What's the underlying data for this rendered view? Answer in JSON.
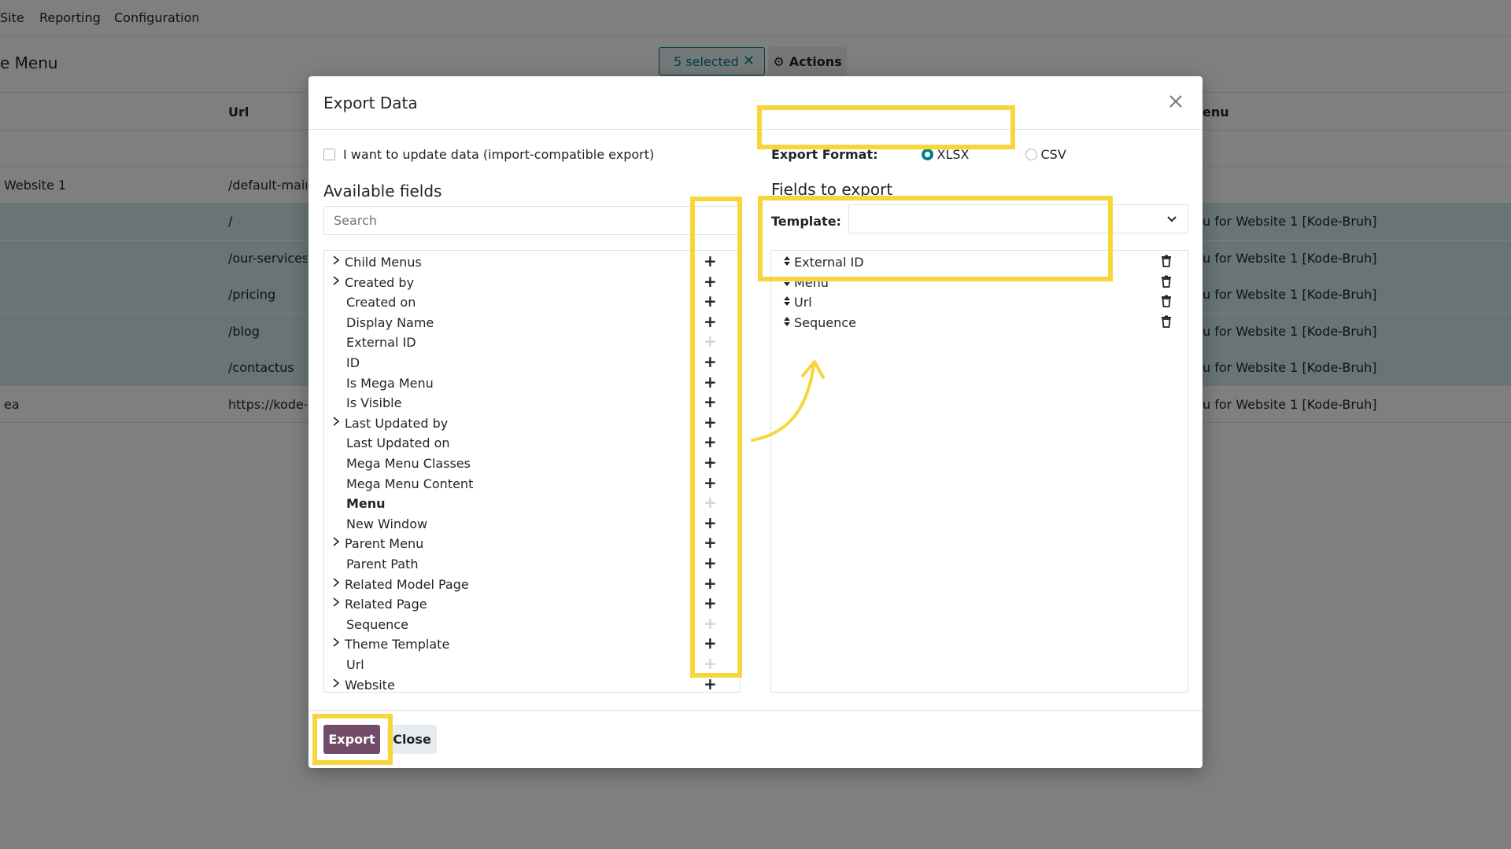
{
  "topbar": {
    "items": [
      "Site",
      "Reporting",
      "Configuration"
    ]
  },
  "control": {
    "breadcrumb": "e Menu",
    "selected_badge": "5 selected",
    "actions_label": "Actions"
  },
  "list": {
    "headers": {
      "url": "Url",
      "menu": "enu"
    },
    "rows": [
      {
        "name": "",
        "url": "",
        "menu": "",
        "selected": false
      },
      {
        "name": "Website 1",
        "url": "/default-main-",
        "menu": "",
        "selected": false
      },
      {
        "name": "",
        "url": "/",
        "menu": "u for Website 1 [Kode-Bruh]",
        "selected": true
      },
      {
        "name": "",
        "url": "/our-services",
        "menu": "u for Website 1 [Kode-Bruh]",
        "selected": true
      },
      {
        "name": "",
        "url": "/pricing",
        "menu": "u for Website 1 [Kode-Bruh]",
        "selected": true
      },
      {
        "name": "",
        "url": "/blog",
        "menu": "u for Website 1 [Kode-Bruh]",
        "selected": true
      },
      {
        "name": "",
        "url": "/contactus",
        "menu": "u for Website 1 [Kode-Bruh]",
        "selected": true
      },
      {
        "name": "ea",
        "url": "https://kode-b",
        "menu": "u for Website 1 [Kode-Bruh]",
        "selected": false
      }
    ]
  },
  "dialog": {
    "title": "Export Data",
    "import_compat_label": "I want to update data (import-compatible export)",
    "available_title": "Available fields",
    "search_placeholder": "Search",
    "available_fields": [
      {
        "label": "Child Menus",
        "expandable": true,
        "bold": false,
        "addable": true
      },
      {
        "label": "Created by",
        "expandable": true,
        "bold": false,
        "addable": true
      },
      {
        "label": "Created on",
        "expandable": false,
        "bold": false,
        "addable": true
      },
      {
        "label": "Display Name",
        "expandable": false,
        "bold": false,
        "addable": true
      },
      {
        "label": "External ID",
        "expandable": false,
        "bold": false,
        "addable": false
      },
      {
        "label": "ID",
        "expandable": false,
        "bold": false,
        "addable": true
      },
      {
        "label": "Is Mega Menu",
        "expandable": false,
        "bold": false,
        "addable": true
      },
      {
        "label": "Is Visible",
        "expandable": false,
        "bold": false,
        "addable": true
      },
      {
        "label": "Last Updated by",
        "expandable": true,
        "bold": false,
        "addable": true
      },
      {
        "label": "Last Updated on",
        "expandable": false,
        "bold": false,
        "addable": true
      },
      {
        "label": "Mega Menu Classes",
        "expandable": false,
        "bold": false,
        "addable": true
      },
      {
        "label": "Mega Menu Content",
        "expandable": false,
        "bold": false,
        "addable": true
      },
      {
        "label": "Menu",
        "expandable": false,
        "bold": true,
        "addable": false
      },
      {
        "label": "New Window",
        "expandable": false,
        "bold": false,
        "addable": true
      },
      {
        "label": "Parent Menu",
        "expandable": true,
        "bold": false,
        "addable": true
      },
      {
        "label": "Parent Path",
        "expandable": false,
        "bold": false,
        "addable": true
      },
      {
        "label": "Related Model Page",
        "expandable": true,
        "bold": false,
        "addable": true
      },
      {
        "label": "Related Page",
        "expandable": true,
        "bold": false,
        "addable": true
      },
      {
        "label": "Sequence",
        "expandable": false,
        "bold": false,
        "addable": false
      },
      {
        "label": "Theme Template",
        "expandable": true,
        "bold": false,
        "addable": true
      },
      {
        "label": "Url",
        "expandable": false,
        "bold": false,
        "addable": false
      },
      {
        "label": "Website",
        "expandable": true,
        "bold": false,
        "addable": true
      }
    ],
    "export_format_label": "Export Format:",
    "formats": [
      {
        "label": "XLSX",
        "checked": true
      },
      {
        "label": "CSV",
        "checked": false
      }
    ],
    "fields_to_export_title": "Fields to export",
    "template_label": "Template:",
    "template_value": "",
    "export_fields": [
      "External ID",
      "Menu",
      "Url",
      "Sequence"
    ],
    "export_button": "Export",
    "close_button": "Close"
  },
  "colors": {
    "primary": "#714b67",
    "accent": "#017e84",
    "highlight": "#f8d53b"
  }
}
